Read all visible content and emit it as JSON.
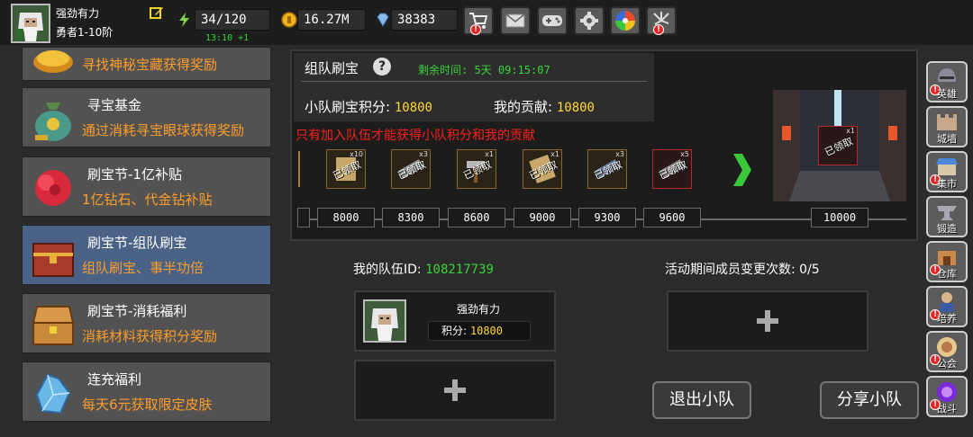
{
  "player": {
    "name": "强劲有力",
    "rank": "勇者1-10阶"
  },
  "resources": {
    "energy": "34/120",
    "energy_regen": "13:10 +1",
    "gold": "16.27M",
    "diamond": "38383"
  },
  "menu": {
    "items": [
      {
        "title": "",
        "desc": "寻找神秘宝藏获得奖励"
      },
      {
        "title": "寻宝基金",
        "desc": "通过消耗寻宝眼球获得奖励"
      },
      {
        "title": "刷宝节-1亿补贴",
        "desc": "1亿钻石、代金钻补贴"
      },
      {
        "title": "刷宝节-组队刷宝",
        "desc": "组队刷宝、事半功倍"
      },
      {
        "title": "刷宝节-消耗福利",
        "desc": "消耗材料获得积分奖励"
      },
      {
        "title": "连充福利",
        "desc": "每天6元获取限定皮肤"
      }
    ]
  },
  "panel": {
    "title": "组队刷宝",
    "help": "?",
    "remaining": "剩余时间: 5天 09:15:07",
    "team_score_label": "小队刷宝积分:",
    "team_score": "10800",
    "contrib_label": "我的贡献:",
    "contrib": "10800",
    "notice": "只有加入队伍才能获得小队积分和我的贡献",
    "claimed_label": "已领取",
    "reward_counts": [
      "x10",
      "x3",
      "x1",
      "x1",
      "x3",
      "x5"
    ],
    "final_count": "x1",
    "milestones": [
      "8000",
      "8300",
      "8600",
      "9000",
      "9300",
      "9600"
    ],
    "final_milestone": "10000"
  },
  "team": {
    "id_label": "我的队伍ID:",
    "id": "108217739",
    "changes_label": "活动期间成员变更次数:",
    "changes": "0/5",
    "member_name": "强劲有力",
    "member_score_label": "积分:",
    "member_score": "10800",
    "leave_button": "退出小队",
    "share_button": "分享小队"
  },
  "nav": {
    "items": [
      "英雄",
      "城墙",
      "集市",
      "锻造",
      "仓库",
      "培养",
      "公会",
      "战斗"
    ]
  },
  "colors": {
    "accent_orange": "#ff9d2a",
    "gold_value": "#ffd83a",
    "green_text": "#39d339",
    "alert_red": "#ff1e1e",
    "active_menu": "#4a6285"
  }
}
